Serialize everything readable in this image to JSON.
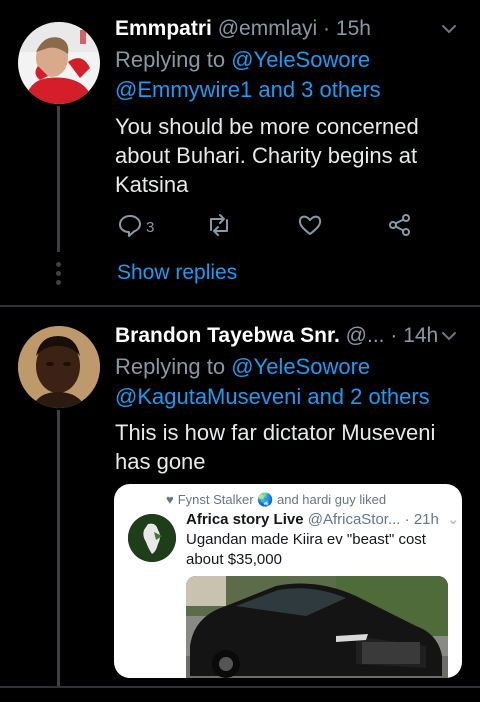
{
  "tweets": [
    {
      "author_name": "Emmpatri",
      "handle": "@emmlayi",
      "separator": "·",
      "time": "15h",
      "replying_prefix": "Replying to",
      "replying_to_1": "@YeleSowore",
      "replying_to_2": "@Emmywire1 and 3 others",
      "text": "You should be more concerned about Buhari. Charity begins at Katsina",
      "reply_count": "3",
      "show_replies": "Show replies"
    },
    {
      "author_name": "Brandon Tayebwa Snr.",
      "handle": "@...",
      "separator": "·",
      "time": "14h",
      "replying_prefix": "Replying to",
      "replying_to_1": "@YeleSowore",
      "replying_to_2": "@KagutaMuseveni and 2 others",
      "text": "This is how far dictator Museveni has gone"
    }
  ],
  "quote": {
    "liked_by": "Fynst Stalker 🌏 and hardi guy liked",
    "author_name": "Africa story Live",
    "handle": "@AfricaStor...",
    "separator": "·",
    "time": "21h",
    "text": "Ugandan made Kiira ev \"beast\" cost about $35,000"
  },
  "colors": {
    "background": "#000000",
    "link": "#1d9bf0",
    "muted": "#8899a6",
    "divider": "#2f3336"
  }
}
